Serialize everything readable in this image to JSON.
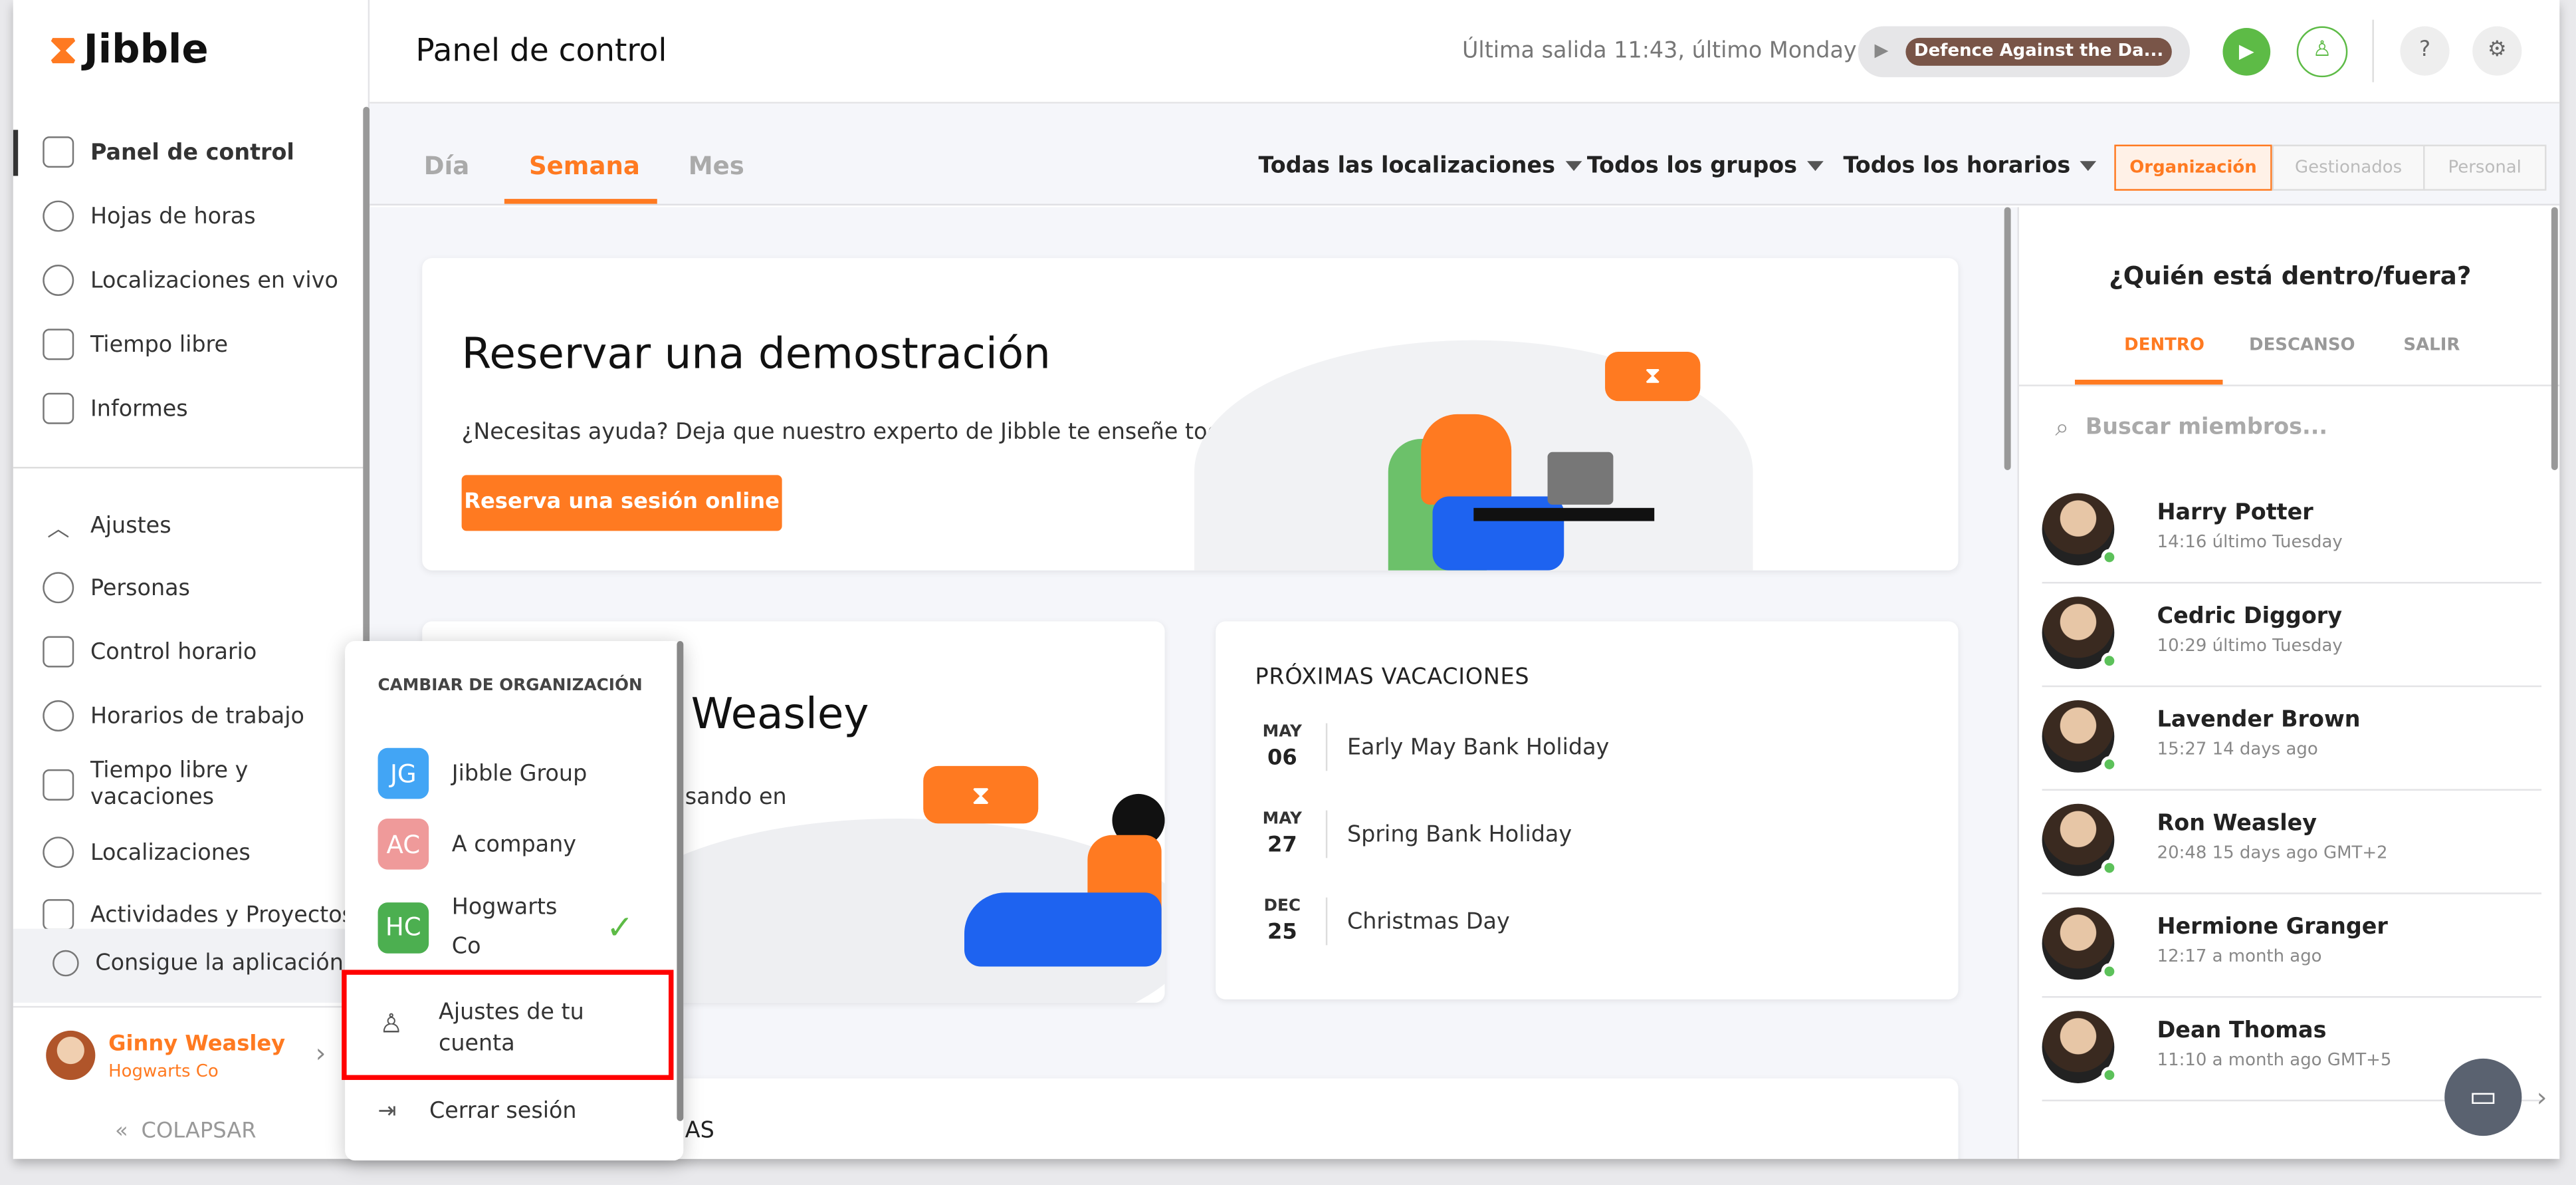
{
  "app": {
    "logo": "Jibble",
    "accent": "#ff7a21"
  },
  "sidebar": {
    "items": [
      {
        "label": "Panel de control",
        "icon": "dashboard-icon",
        "active": true
      },
      {
        "label": "Hojas de horas",
        "icon": "clock-icon"
      },
      {
        "label": "Localizaciones en vivo",
        "icon": "map-pin-icon"
      },
      {
        "label": "Tiempo libre",
        "icon": "suitcase-icon"
      },
      {
        "label": "Informes",
        "icon": "clipboard-icon"
      }
    ],
    "settings": [
      {
        "label": "Ajustes",
        "icon": "chevron-up-icon"
      },
      {
        "label": "Personas",
        "icon": "people-icon"
      },
      {
        "label": "Control horario",
        "icon": "time-tracking-icon"
      },
      {
        "label": "Horarios de trabajo",
        "icon": "schedule-icon"
      },
      {
        "label": "Tiempo libre y vacaciones",
        "icon": "suitcase-icon"
      },
      {
        "label": "Localizaciones",
        "icon": "map-pin-icon"
      },
      {
        "label": "Actividades y Proyectos",
        "icon": "tag-icon"
      }
    ],
    "get_app": "Consigue la aplicación",
    "user": {
      "name": "Ginny Weasley",
      "org": "Hogwarts Co"
    },
    "collapse": "COLAPSAR"
  },
  "header": {
    "title": "Panel de control",
    "last_out": "Última salida 11:43, último Monday",
    "activity": "Defence Against the Da..."
  },
  "tabs": [
    {
      "label": "Día"
    },
    {
      "label": "Semana",
      "active": true
    },
    {
      "label": "Mes"
    }
  ],
  "filters": {
    "locations": "Todas las localizaciones",
    "groups": "Todos los grupos",
    "schedules": "Todos los horarios"
  },
  "scope": [
    {
      "label": "Organización",
      "active": true
    },
    {
      "label": "Gestionados"
    },
    {
      "label": "Personal"
    }
  ],
  "demo": {
    "title": "Reservar una demostración",
    "text": "¿Necesitas ayuda? Deja que nuestro experto de Jibble te enseñe todo.",
    "button": "Reserva una sesión online"
  },
  "welcome": {
    "title_partial": "y Weasley",
    "text_partial": "sando en"
  },
  "holidays": {
    "title": "PRÓXIMAS VACACIONES",
    "items": [
      {
        "month": "MAY",
        "day": "06",
        "name": "Early May Bank Holiday"
      },
      {
        "month": "MAY",
        "day": "27",
        "name": "Spring Bank Holiday"
      },
      {
        "month": "DEC",
        "day": "25",
        "name": "Christmas Day"
      }
    ]
  },
  "bottom_card": {
    "title_partial": "AS"
  },
  "who": {
    "title": "¿Quién está dentro/fuera?",
    "tabs": [
      {
        "label": "DENTRO",
        "active": true
      },
      {
        "label": "DESCANSO"
      },
      {
        "label": "SALIR"
      }
    ],
    "search_placeholder": "Buscar miembros...",
    "members": [
      {
        "name": "Harry Potter",
        "time": "14:16 último Tuesday"
      },
      {
        "name": "Cedric Diggory",
        "time": "10:29 último Tuesday"
      },
      {
        "name": "Lavender Brown",
        "time": "15:27 14 days ago"
      },
      {
        "name": "Ron Weasley",
        "time": "20:48 15 days ago GMT+2"
      },
      {
        "name": "Hermione Granger",
        "time": "12:17 a month ago"
      },
      {
        "name": "Dean Thomas",
        "time": "11:10 a month ago GMT+5"
      }
    ]
  },
  "menu": {
    "heading": "CAMBIAR DE ORGANIZACIÓN",
    "orgs": [
      {
        "initials": "JG",
        "name": "Jibble Group",
        "color": "#42a5f5"
      },
      {
        "initials": "AC",
        "name": "A company",
        "color": "#ef9a9a"
      },
      {
        "initials": "HC",
        "name": "Hogwarts Co",
        "color": "#4caf50",
        "selected": true
      }
    ],
    "account": "Ajustes de tu cuenta",
    "logout": "Cerrar sesión"
  }
}
